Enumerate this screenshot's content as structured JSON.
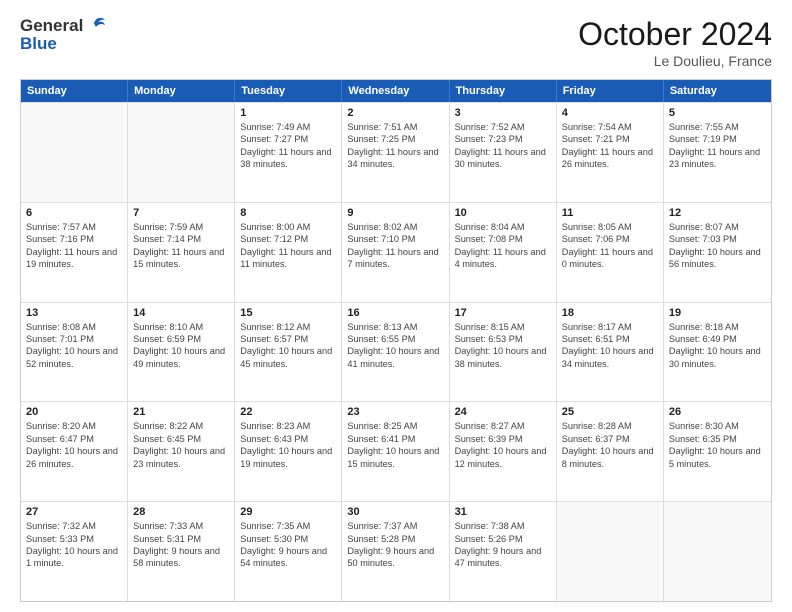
{
  "header": {
    "logo_general": "General",
    "logo_blue": "Blue",
    "title": "October 2024",
    "subtitle": "Le Doulieu, France"
  },
  "days_of_week": [
    "Sunday",
    "Monday",
    "Tuesday",
    "Wednesday",
    "Thursday",
    "Friday",
    "Saturday"
  ],
  "weeks": [
    [
      {
        "day": "",
        "info": "",
        "empty": true
      },
      {
        "day": "",
        "info": "",
        "empty": true
      },
      {
        "day": "1",
        "info": "Sunrise: 7:49 AM\nSunset: 7:27 PM\nDaylight: 11 hours and 38 minutes."
      },
      {
        "day": "2",
        "info": "Sunrise: 7:51 AM\nSunset: 7:25 PM\nDaylight: 11 hours and 34 minutes."
      },
      {
        "day": "3",
        "info": "Sunrise: 7:52 AM\nSunset: 7:23 PM\nDaylight: 11 hours and 30 minutes."
      },
      {
        "day": "4",
        "info": "Sunrise: 7:54 AM\nSunset: 7:21 PM\nDaylight: 11 hours and 26 minutes."
      },
      {
        "day": "5",
        "info": "Sunrise: 7:55 AM\nSunset: 7:19 PM\nDaylight: 11 hours and 23 minutes."
      }
    ],
    [
      {
        "day": "6",
        "info": "Sunrise: 7:57 AM\nSunset: 7:16 PM\nDaylight: 11 hours and 19 minutes."
      },
      {
        "day": "7",
        "info": "Sunrise: 7:59 AM\nSunset: 7:14 PM\nDaylight: 11 hours and 15 minutes."
      },
      {
        "day": "8",
        "info": "Sunrise: 8:00 AM\nSunset: 7:12 PM\nDaylight: 11 hours and 11 minutes."
      },
      {
        "day": "9",
        "info": "Sunrise: 8:02 AM\nSunset: 7:10 PM\nDaylight: 11 hours and 7 minutes."
      },
      {
        "day": "10",
        "info": "Sunrise: 8:04 AM\nSunset: 7:08 PM\nDaylight: 11 hours and 4 minutes."
      },
      {
        "day": "11",
        "info": "Sunrise: 8:05 AM\nSunset: 7:06 PM\nDaylight: 11 hours and 0 minutes."
      },
      {
        "day": "12",
        "info": "Sunrise: 8:07 AM\nSunset: 7:03 PM\nDaylight: 10 hours and 56 minutes."
      }
    ],
    [
      {
        "day": "13",
        "info": "Sunrise: 8:08 AM\nSunset: 7:01 PM\nDaylight: 10 hours and 52 minutes."
      },
      {
        "day": "14",
        "info": "Sunrise: 8:10 AM\nSunset: 6:59 PM\nDaylight: 10 hours and 49 minutes."
      },
      {
        "day": "15",
        "info": "Sunrise: 8:12 AM\nSunset: 6:57 PM\nDaylight: 10 hours and 45 minutes."
      },
      {
        "day": "16",
        "info": "Sunrise: 8:13 AM\nSunset: 6:55 PM\nDaylight: 10 hours and 41 minutes."
      },
      {
        "day": "17",
        "info": "Sunrise: 8:15 AM\nSunset: 6:53 PM\nDaylight: 10 hours and 38 minutes."
      },
      {
        "day": "18",
        "info": "Sunrise: 8:17 AM\nSunset: 6:51 PM\nDaylight: 10 hours and 34 minutes."
      },
      {
        "day": "19",
        "info": "Sunrise: 8:18 AM\nSunset: 6:49 PM\nDaylight: 10 hours and 30 minutes."
      }
    ],
    [
      {
        "day": "20",
        "info": "Sunrise: 8:20 AM\nSunset: 6:47 PM\nDaylight: 10 hours and 26 minutes."
      },
      {
        "day": "21",
        "info": "Sunrise: 8:22 AM\nSunset: 6:45 PM\nDaylight: 10 hours and 23 minutes."
      },
      {
        "day": "22",
        "info": "Sunrise: 8:23 AM\nSunset: 6:43 PM\nDaylight: 10 hours and 19 minutes."
      },
      {
        "day": "23",
        "info": "Sunrise: 8:25 AM\nSunset: 6:41 PM\nDaylight: 10 hours and 15 minutes."
      },
      {
        "day": "24",
        "info": "Sunrise: 8:27 AM\nSunset: 6:39 PM\nDaylight: 10 hours and 12 minutes."
      },
      {
        "day": "25",
        "info": "Sunrise: 8:28 AM\nSunset: 6:37 PM\nDaylight: 10 hours and 8 minutes."
      },
      {
        "day": "26",
        "info": "Sunrise: 8:30 AM\nSunset: 6:35 PM\nDaylight: 10 hours and 5 minutes."
      }
    ],
    [
      {
        "day": "27",
        "info": "Sunrise: 7:32 AM\nSunset: 5:33 PM\nDaylight: 10 hours and 1 minute."
      },
      {
        "day": "28",
        "info": "Sunrise: 7:33 AM\nSunset: 5:31 PM\nDaylight: 9 hours and 58 minutes."
      },
      {
        "day": "29",
        "info": "Sunrise: 7:35 AM\nSunset: 5:30 PM\nDaylight: 9 hours and 54 minutes."
      },
      {
        "day": "30",
        "info": "Sunrise: 7:37 AM\nSunset: 5:28 PM\nDaylight: 9 hours and 50 minutes."
      },
      {
        "day": "31",
        "info": "Sunrise: 7:38 AM\nSunset: 5:26 PM\nDaylight: 9 hours and 47 minutes."
      },
      {
        "day": "",
        "info": "",
        "empty": true
      },
      {
        "day": "",
        "info": "",
        "empty": true
      }
    ]
  ]
}
